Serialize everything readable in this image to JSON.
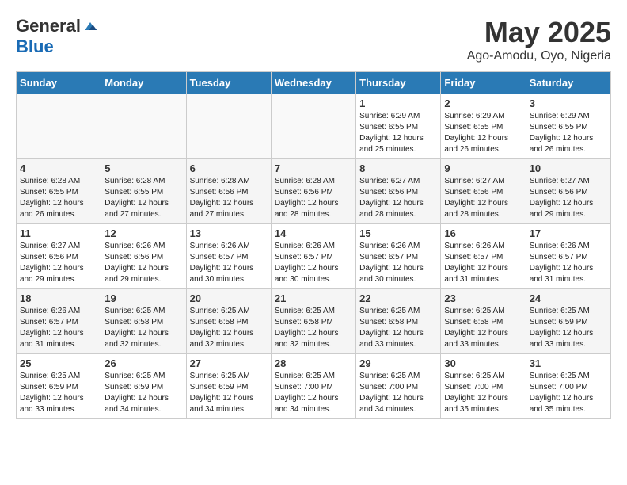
{
  "logo": {
    "general": "General",
    "blue": "Blue"
  },
  "title": "May 2025",
  "location": "Ago-Amodu, Oyo, Nigeria",
  "weekdays": [
    "Sunday",
    "Monday",
    "Tuesday",
    "Wednesday",
    "Thursday",
    "Friday",
    "Saturday"
  ],
  "weeks": [
    [
      {
        "day": "",
        "info": ""
      },
      {
        "day": "",
        "info": ""
      },
      {
        "day": "",
        "info": ""
      },
      {
        "day": "",
        "info": ""
      },
      {
        "day": "1",
        "info": "Sunrise: 6:29 AM\nSunset: 6:55 PM\nDaylight: 12 hours\nand 25 minutes."
      },
      {
        "day": "2",
        "info": "Sunrise: 6:29 AM\nSunset: 6:55 PM\nDaylight: 12 hours\nand 26 minutes."
      },
      {
        "day": "3",
        "info": "Sunrise: 6:29 AM\nSunset: 6:55 PM\nDaylight: 12 hours\nand 26 minutes."
      }
    ],
    [
      {
        "day": "4",
        "info": "Sunrise: 6:28 AM\nSunset: 6:55 PM\nDaylight: 12 hours\nand 26 minutes."
      },
      {
        "day": "5",
        "info": "Sunrise: 6:28 AM\nSunset: 6:55 PM\nDaylight: 12 hours\nand 27 minutes."
      },
      {
        "day": "6",
        "info": "Sunrise: 6:28 AM\nSunset: 6:56 PM\nDaylight: 12 hours\nand 27 minutes."
      },
      {
        "day": "7",
        "info": "Sunrise: 6:28 AM\nSunset: 6:56 PM\nDaylight: 12 hours\nand 28 minutes."
      },
      {
        "day": "8",
        "info": "Sunrise: 6:27 AM\nSunset: 6:56 PM\nDaylight: 12 hours\nand 28 minutes."
      },
      {
        "day": "9",
        "info": "Sunrise: 6:27 AM\nSunset: 6:56 PM\nDaylight: 12 hours\nand 28 minutes."
      },
      {
        "day": "10",
        "info": "Sunrise: 6:27 AM\nSunset: 6:56 PM\nDaylight: 12 hours\nand 29 minutes."
      }
    ],
    [
      {
        "day": "11",
        "info": "Sunrise: 6:27 AM\nSunset: 6:56 PM\nDaylight: 12 hours\nand 29 minutes."
      },
      {
        "day": "12",
        "info": "Sunrise: 6:26 AM\nSunset: 6:56 PM\nDaylight: 12 hours\nand 29 minutes."
      },
      {
        "day": "13",
        "info": "Sunrise: 6:26 AM\nSunset: 6:57 PM\nDaylight: 12 hours\nand 30 minutes."
      },
      {
        "day": "14",
        "info": "Sunrise: 6:26 AM\nSunset: 6:57 PM\nDaylight: 12 hours\nand 30 minutes."
      },
      {
        "day": "15",
        "info": "Sunrise: 6:26 AM\nSunset: 6:57 PM\nDaylight: 12 hours\nand 30 minutes."
      },
      {
        "day": "16",
        "info": "Sunrise: 6:26 AM\nSunset: 6:57 PM\nDaylight: 12 hours\nand 31 minutes."
      },
      {
        "day": "17",
        "info": "Sunrise: 6:26 AM\nSunset: 6:57 PM\nDaylight: 12 hours\nand 31 minutes."
      }
    ],
    [
      {
        "day": "18",
        "info": "Sunrise: 6:26 AM\nSunset: 6:57 PM\nDaylight: 12 hours\nand 31 minutes."
      },
      {
        "day": "19",
        "info": "Sunrise: 6:25 AM\nSunset: 6:58 PM\nDaylight: 12 hours\nand 32 minutes."
      },
      {
        "day": "20",
        "info": "Sunrise: 6:25 AM\nSunset: 6:58 PM\nDaylight: 12 hours\nand 32 minutes."
      },
      {
        "day": "21",
        "info": "Sunrise: 6:25 AM\nSunset: 6:58 PM\nDaylight: 12 hours\nand 32 minutes."
      },
      {
        "day": "22",
        "info": "Sunrise: 6:25 AM\nSunset: 6:58 PM\nDaylight: 12 hours\nand 33 minutes."
      },
      {
        "day": "23",
        "info": "Sunrise: 6:25 AM\nSunset: 6:58 PM\nDaylight: 12 hours\nand 33 minutes."
      },
      {
        "day": "24",
        "info": "Sunrise: 6:25 AM\nSunset: 6:59 PM\nDaylight: 12 hours\nand 33 minutes."
      }
    ],
    [
      {
        "day": "25",
        "info": "Sunrise: 6:25 AM\nSunset: 6:59 PM\nDaylight: 12 hours\nand 33 minutes."
      },
      {
        "day": "26",
        "info": "Sunrise: 6:25 AM\nSunset: 6:59 PM\nDaylight: 12 hours\nand 34 minutes."
      },
      {
        "day": "27",
        "info": "Sunrise: 6:25 AM\nSunset: 6:59 PM\nDaylight: 12 hours\nand 34 minutes."
      },
      {
        "day": "28",
        "info": "Sunrise: 6:25 AM\nSunset: 7:00 PM\nDaylight: 12 hours\nand 34 minutes."
      },
      {
        "day": "29",
        "info": "Sunrise: 6:25 AM\nSunset: 7:00 PM\nDaylight: 12 hours\nand 34 minutes."
      },
      {
        "day": "30",
        "info": "Sunrise: 6:25 AM\nSunset: 7:00 PM\nDaylight: 12 hours\nand 35 minutes."
      },
      {
        "day": "31",
        "info": "Sunrise: 6:25 AM\nSunset: 7:00 PM\nDaylight: 12 hours\nand 35 minutes."
      }
    ]
  ]
}
